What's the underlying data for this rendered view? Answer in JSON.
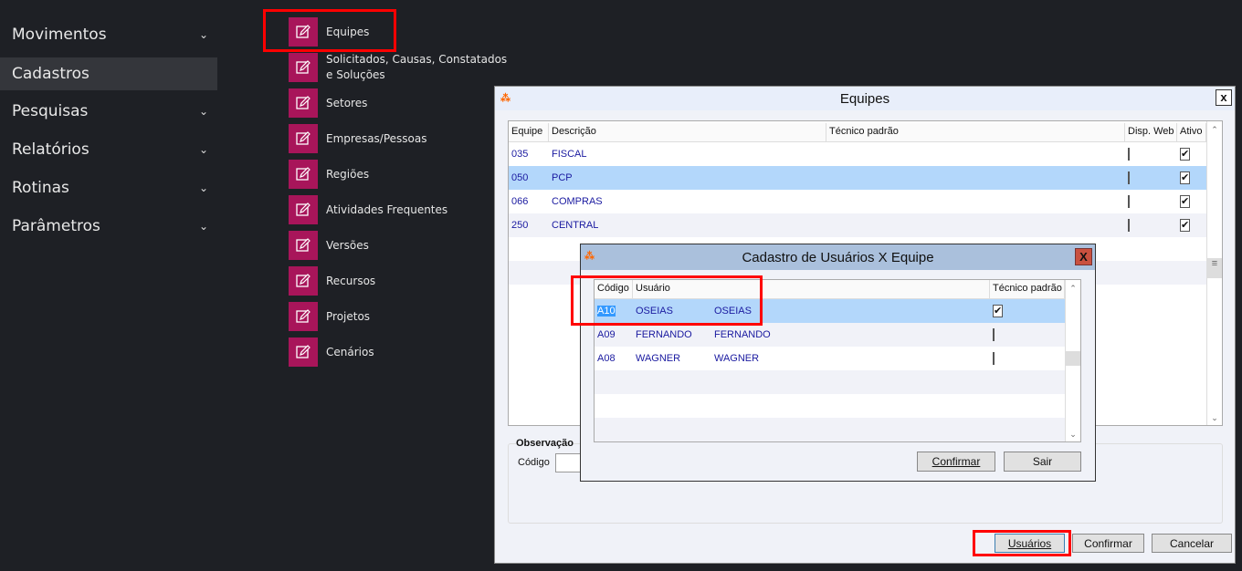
{
  "sidebar": {
    "items": [
      {
        "label": "Movimentos"
      },
      {
        "label": "Cadastros"
      },
      {
        "label": "Pesquisas"
      },
      {
        "label": "Relatórios"
      },
      {
        "label": "Rotinas"
      },
      {
        "label": "Parâmetros"
      }
    ]
  },
  "submenu": {
    "items": [
      "Equipes",
      "Solicitados, Causas, Constatados e Soluções",
      "Setores",
      "Empresas/Pessoas",
      "Regiões",
      "Atividades Frequentes",
      "Versões",
      "Recursos",
      "Projetos",
      "Cenários"
    ]
  },
  "equipes": {
    "title": "Equipes",
    "close": "x",
    "columns": [
      "Equipe",
      "Descrição",
      "Técnico padrão",
      "Disp. Web",
      "Ativo"
    ],
    "rows": [
      {
        "code": "035",
        "desc": "FISCAL",
        "web": false,
        "ativo": true
      },
      {
        "code": "050",
        "desc": "PCP",
        "web": false,
        "ativo": true
      },
      {
        "code": "066",
        "desc": "COMPRAS",
        "web": false,
        "ativo": true
      },
      {
        "code": "250",
        "desc": "CENTRAL",
        "web": false,
        "ativo": true
      }
    ],
    "obs_label": "Observação",
    "codigo_label": "Código",
    "buttons": {
      "usuarios": "Usuários",
      "confirmar": "Confirmar",
      "cancelar": "Cancelar"
    }
  },
  "cadastro": {
    "title": "Cadastro de Usuários X  Equipe",
    "close": "X",
    "columns": [
      "Código",
      "Usuário",
      "Técnico padrão"
    ],
    "rows": [
      {
        "code": "A10",
        "user": "OSEIAS",
        "name": "OSEIAS",
        "tecnico": true
      },
      {
        "code": "A09",
        "user": "FERNANDO",
        "name": "FERNANDO",
        "tecnico": false
      },
      {
        "code": "A08",
        "user": "WAGNER",
        "name": "WAGNER",
        "tecnico": false
      }
    ],
    "buttons": {
      "confirmar": "Confirmar",
      "sair": "Sair"
    }
  },
  "colors": {
    "accent": "#a8155a",
    "highlight": "#ff0000",
    "selection": "#b3d7fb"
  }
}
